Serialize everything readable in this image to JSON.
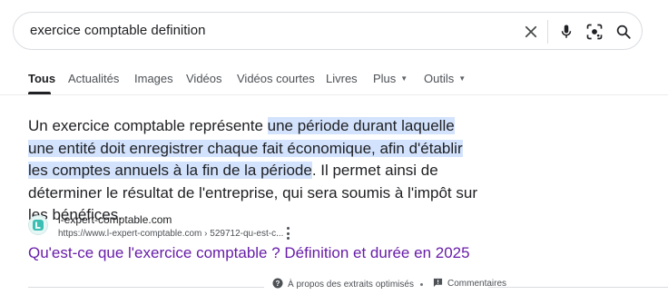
{
  "search": {
    "query": "exercice comptable definition"
  },
  "icons": {
    "clear": "close-icon",
    "voice": "microphone-icon",
    "lens": "camera-lens-icon",
    "search": "search-icon"
  },
  "tabs": [
    {
      "label": "Tous",
      "active": true
    },
    {
      "label": "Actualités"
    },
    {
      "label": "Images"
    },
    {
      "label": "Vidéos"
    },
    {
      "label": "Vidéos courtes"
    },
    {
      "label": "Livres"
    },
    {
      "label": "Plus"
    },
    {
      "label": "Outils"
    }
  ],
  "snippet": {
    "before": "Un exercice comptable représente ",
    "highlight": "une période durant laquelle une entité doit enregistrer chaque fait économique, afin d'établir les comptes annuels à la fin de la période",
    "after": ". Il permet ainsi de déterminer le résultat de l'entreprise, qui sera soumis à l'impôt sur les bénéfices."
  },
  "source": {
    "site_name": "l-expert-comptable.com",
    "url": "https://www.l-expert-comptable.com › 529712-qu-est-c...",
    "title": "Qu'est-ce que l'exercice comptable ? Définition et durée en 2025",
    "favicon_letter": "L"
  },
  "footer": {
    "about": "À propos des extraits optimisés",
    "feedback": "Commentaires"
  },
  "colors": {
    "highlight": "#d3e3fd",
    "link_visited": "#681da8",
    "favicon": "#3bbfb3"
  }
}
